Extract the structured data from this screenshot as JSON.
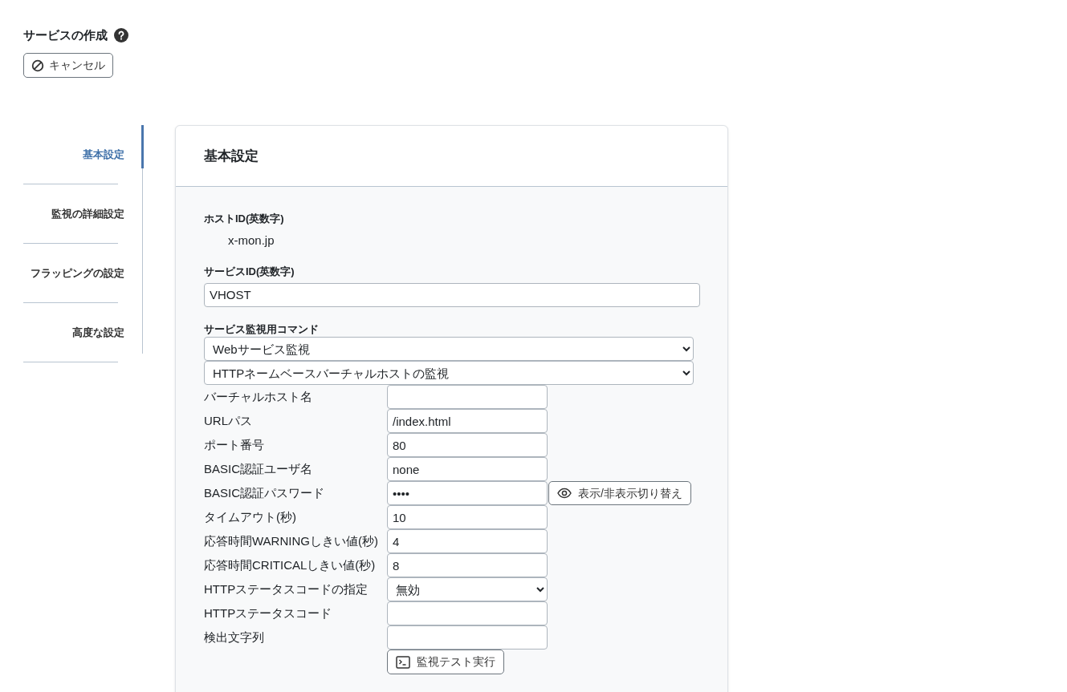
{
  "page": {
    "title": "サービスの作成",
    "cancel_button": "キャンセル"
  },
  "sidebar": {
    "items": [
      {
        "label": "基本設定",
        "selected": true
      },
      {
        "label": "監視の詳細設定",
        "selected": false
      },
      {
        "label": "フラッピングの設定",
        "selected": false
      },
      {
        "label": "高度な設定",
        "selected": false
      }
    ]
  },
  "card": {
    "title": "基本設定",
    "host_id": {
      "label": "ホストID(英数字)",
      "value": "x-mon.jp"
    },
    "service_id": {
      "label": "サービスID(英数字)",
      "value": "VHOST"
    },
    "command": {
      "label": "サービス監視用コマンド",
      "selects": [
        "Webサービス監視",
        "HTTPネームベースバーチャルホストの監視"
      ]
    },
    "fields": [
      {
        "kind": "text",
        "label": "バーチャルホスト名"
      },
      {
        "kind": "text",
        "label": "URLパス",
        "value": "/index.html"
      },
      {
        "kind": "text",
        "label": "ポート番号",
        "value": "80"
      },
      {
        "kind": "text",
        "label": "BASIC認証ユーザ名",
        "value": "none"
      },
      {
        "kind": "password",
        "label": "BASIC認証パスワード",
        "value": "••••",
        "toggle_button": "表示/非表示切り替え"
      },
      {
        "kind": "text",
        "label": "タイムアウト(秒)",
        "value": "10"
      },
      {
        "kind": "text",
        "label": "応答時間WARNINGしきい値(秒)",
        "value": "4"
      },
      {
        "kind": "text",
        "label": "応答時間CRITICALしきい値(秒)",
        "value": "8"
      },
      {
        "kind": "select",
        "label": "HTTPステータスコードの指定",
        "value": "無効"
      },
      {
        "kind": "text",
        "label": "HTTPステータスコード"
      },
      {
        "kind": "text",
        "label": "検出文字列"
      }
    ],
    "test_button": "監視テスト実行"
  }
}
